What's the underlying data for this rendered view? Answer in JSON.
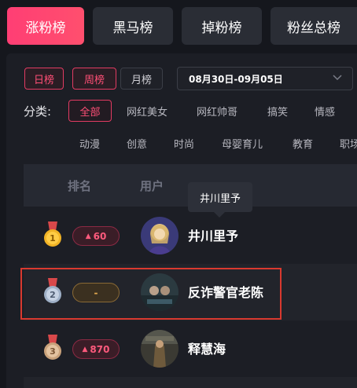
{
  "tabs": [
    {
      "label": "涨粉榜",
      "active": true
    },
    {
      "label": "黑马榜",
      "active": false
    },
    {
      "label": "掉粉榜",
      "active": false
    },
    {
      "label": "粉丝总榜",
      "active": false
    }
  ],
  "period_tabs": [
    {
      "label": "日榜",
      "selected": true
    },
    {
      "label": "周榜",
      "selected": true
    },
    {
      "label": "月榜",
      "selected": false
    }
  ],
  "date_range": {
    "value": "08月30日-09月05日",
    "icon": "chevron-down-icon"
  },
  "category": {
    "label": "分类:",
    "items": [
      "全部",
      "网红美女",
      "网红帅哥",
      "搞笑",
      "情感",
      "动漫",
      "创意",
      "时尚",
      "母婴育儿",
      "教育",
      "职场"
    ],
    "selected": "全部"
  },
  "table": {
    "headers": {
      "rank": "排名",
      "user": "用户"
    },
    "tooltip": "井川里予",
    "rows": [
      {
        "rank": 1,
        "medal": "gold-medal-icon",
        "change": "60",
        "change_dir": "up",
        "name": "井川里予"
      },
      {
        "rank": 2,
        "medal": "silver-medal-icon",
        "change": "-",
        "change_dir": "flat",
        "name": "反诈警官老陈"
      },
      {
        "rank": 3,
        "medal": "bronze-medal-icon",
        "change": "870",
        "change_dir": "up",
        "name": "释慧海"
      }
    ]
  },
  "colors": {
    "accent": "#ff3e74",
    "up": "#ff5a7d",
    "flat": "#e3a94f",
    "highlight": "#d9392f"
  }
}
